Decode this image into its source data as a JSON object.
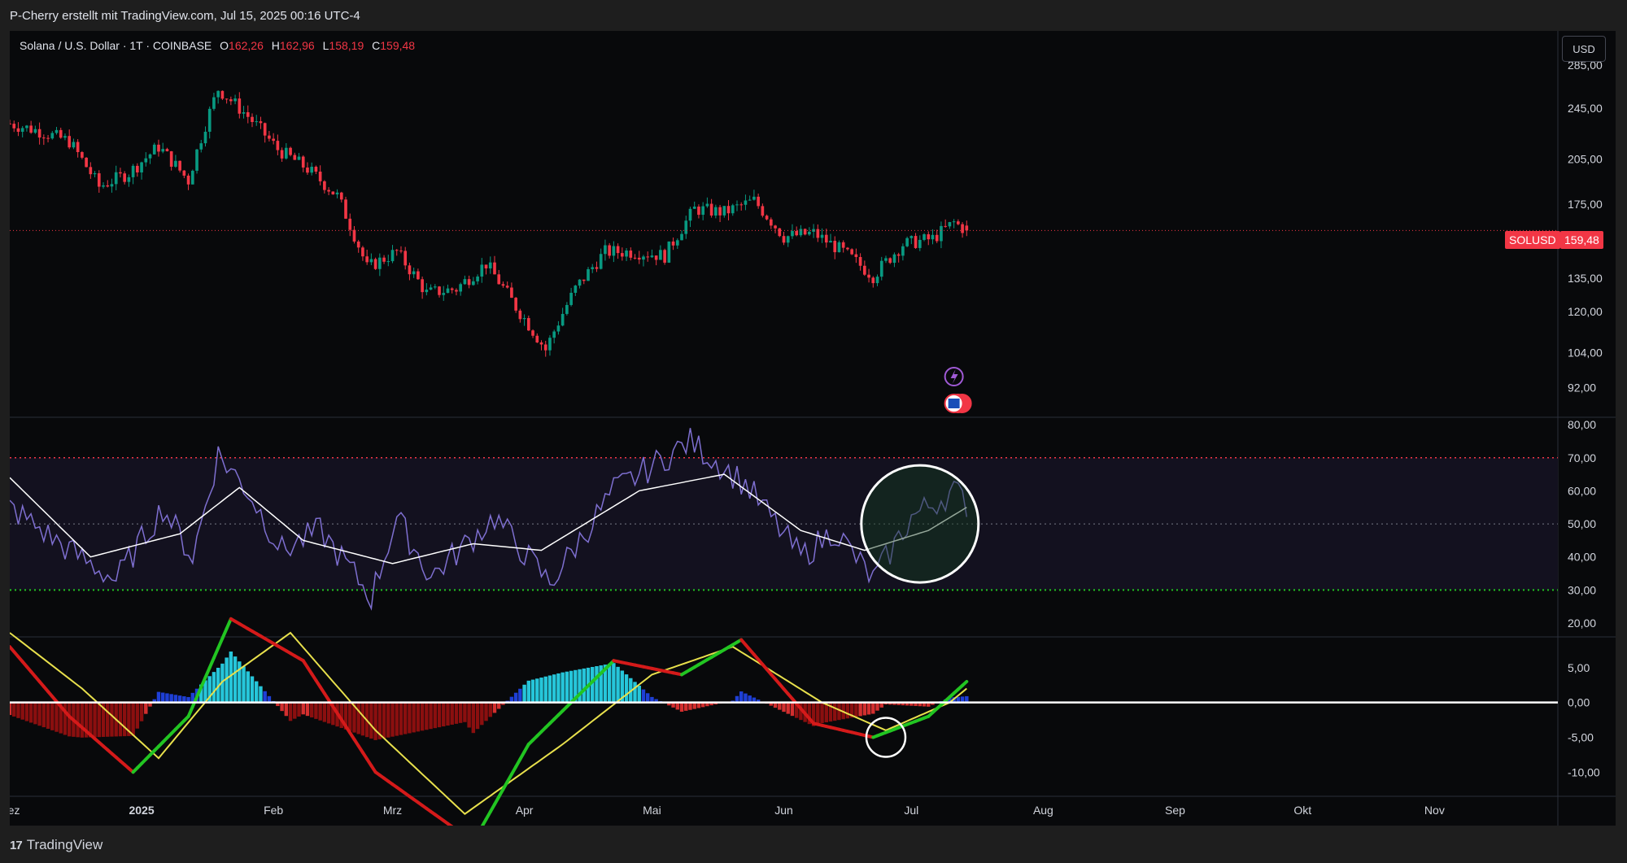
{
  "header": {
    "caption": "P-Cherry erstellt mit TradingView.com, Jul 15, 2025 00:16 UTC-4"
  },
  "legend": {
    "symbol": "Solana / U.S. Dollar · 1T · COINBASE",
    "open_label": "O",
    "open": "162,26",
    "high_label": "H",
    "high": "162,96",
    "low_label": "L",
    "low": "158,19",
    "close_label": "C",
    "close": "159,48"
  },
  "currency_button": "USD",
  "last_price": {
    "symbol": "SOLUSD",
    "value": "159,48"
  },
  "footer": {
    "brand": "TradingView",
    "logo_mark": "17"
  },
  "colors": {
    "background": "#08090b",
    "up": "#089981",
    "down": "#f23645",
    "rsi": "#7e6fd0",
    "rsi_ma": "#ffffff",
    "overbought": "#f23645",
    "oversold": "#22c522",
    "macd_fast": "#e8e04c",
    "histogram_pos": "#26c6da",
    "histogram_neg": "#b71c1c"
  },
  "chart_data": [
    {
      "type": "candlestick",
      "pane": "price",
      "scale": "log",
      "yticks": [
        92,
        104,
        120,
        135,
        175,
        205,
        245,
        285
      ],
      "ytick_labels": [
        "92,00",
        "104,00",
        "120,00",
        "135,00",
        "175,00",
        "205,00",
        "245,00",
        "285,00"
      ],
      "ylim": [
        86,
        305
      ],
      "xlim": [
        "2024-12-01",
        "2025-11-30"
      ],
      "x_ticks": [
        {
          "date": "2024-12-01",
          "label": "Dez"
        },
        {
          "date": "2025-01-01",
          "label": "2025"
        },
        {
          "date": "2025-02-01",
          "label": "Feb"
        },
        {
          "date": "2025-03-01",
          "label": "Mrz"
        },
        {
          "date": "2025-04-01",
          "label": "Apr"
        },
        {
          "date": "2025-05-01",
          "label": "Mai"
        },
        {
          "date": "2025-06-01",
          "label": "Jun"
        },
        {
          "date": "2025-07-01",
          "label": "Jul"
        },
        {
          "date": "2025-08-01",
          "label": "Aug"
        },
        {
          "date": "2025-09-01",
          "label": "Sep"
        },
        {
          "date": "2025-10-01",
          "label": "Okt"
        },
        {
          "date": "2025-11-01",
          "label": "Nov"
        }
      ],
      "close_waypoints": [
        [
          "2024-12-01",
          232
        ],
        [
          "2024-12-08",
          226
        ],
        [
          "2024-12-15",
          218
        ],
        [
          "2024-12-22",
          186
        ],
        [
          "2024-12-29",
          195
        ],
        [
          "2025-01-05",
          214
        ],
        [
          "2025-01-12",
          190
        ],
        [
          "2025-01-19",
          262
        ],
        [
          "2025-01-26",
          238
        ],
        [
          "2025-02-02",
          212
        ],
        [
          "2025-02-09",
          198
        ],
        [
          "2025-02-16",
          180
        ],
        [
          "2025-02-23",
          140
        ],
        [
          "2025-03-02",
          148
        ],
        [
          "2025-03-09",
          128
        ],
        [
          "2025-03-16",
          130
        ],
        [
          "2025-03-23",
          142
        ],
        [
          "2025-03-30",
          122
        ],
        [
          "2025-04-06",
          105
        ],
        [
          "2025-04-13",
          130
        ],
        [
          "2025-04-20",
          148
        ],
        [
          "2025-04-27",
          148
        ],
        [
          "2025-05-04",
          146
        ],
        [
          "2025-05-11",
          172
        ],
        [
          "2025-05-18",
          170
        ],
        [
          "2025-05-25",
          177
        ],
        [
          "2025-06-01",
          156
        ],
        [
          "2025-06-08",
          158
        ],
        [
          "2025-06-15",
          148
        ],
        [
          "2025-06-22",
          136
        ],
        [
          "2025-06-29",
          152
        ],
        [
          "2025-07-06",
          155
        ],
        [
          "2025-07-11",
          164
        ],
        [
          "2025-07-14",
          159.48
        ]
      ]
    },
    {
      "type": "line",
      "pane": "rsi",
      "yticks": [
        20,
        30,
        40,
        50,
        60,
        70,
        80
      ],
      "ytick_labels": [
        "20,00",
        "30,00",
        "40,00",
        "50,00",
        "60,00",
        "70,00",
        "80,00"
      ],
      "ylim": [
        20,
        82
      ],
      "levels": {
        "overbought": 70,
        "middle": 50,
        "oversold": 30
      },
      "series": [
        {
          "values": [
            [
              "2024-12-01",
              55
            ],
            [
              "2024-12-15",
              42
            ],
            [
              "2024-12-26",
              33
            ],
            [
              "2025-01-06",
              55
            ],
            [
              "2025-01-13",
              40
            ],
            [
              "2025-01-19",
              71
            ],
            [
              "2025-01-26",
              60
            ],
            [
              "2025-02-03",
              42
            ],
            [
              "2025-02-12",
              48
            ],
            [
              "2025-02-24",
              28
            ],
            [
              "2025-03-02",
              52
            ],
            [
              "2025-03-10",
              34
            ],
            [
              "2025-03-25",
              52
            ],
            [
              "2025-04-07",
              32
            ],
            [
              "2025-04-22",
              60
            ],
            [
              "2025-05-10",
              75
            ],
            [
              "2025-05-23",
              62
            ],
            [
              "2025-06-05",
              40
            ],
            [
              "2025-06-13",
              48
            ],
            [
              "2025-06-22",
              33
            ],
            [
              "2025-07-01",
              52
            ],
            [
              "2025-07-11",
              60
            ],
            [
              "2025-07-14",
              56
            ]
          ]
        },
        {
          "values": [
            [
              "2024-12-01",
              64
            ],
            [
              "2024-12-20",
              40
            ],
            [
              "2025-01-10",
              47
            ],
            [
              "2025-01-24",
              61
            ],
            [
              "2025-02-08",
              45
            ],
            [
              "2025-03-01",
              38
            ],
            [
              "2025-03-20",
              44
            ],
            [
              "2025-04-05",
              42
            ],
            [
              "2025-04-28",
              60
            ],
            [
              "2025-05-18",
              65
            ],
            [
              "2025-06-05",
              48
            ],
            [
              "2025-06-20",
              42
            ],
            [
              "2025-07-05",
              48
            ],
            [
              "2025-07-14",
              55
            ]
          ]
        }
      ]
    },
    {
      "type": "line",
      "pane": "macd",
      "yticks": [
        -10,
        -5,
        0,
        5
      ],
      "ytick_labels": [
        "-10,00",
        "-5,00",
        "0,00",
        "5,00"
      ],
      "ylim": [
        -13,
        10
      ],
      "series": [
        {
          "values": [
            [
              "2024-12-01",
              8
            ],
            [
              "2024-12-15",
              -2
            ],
            [
              "2024-12-30",
              -10
            ],
            [
              "2025-01-12",
              -2
            ],
            [
              "2025-01-22",
              12
            ],
            [
              "2025-02-08",
              6
            ],
            [
              "2025-02-25",
              -10
            ],
            [
              "2025-03-20",
              -20
            ],
            [
              "2025-04-02",
              -6
            ],
            [
              "2025-04-22",
              6
            ],
            [
              "2025-05-08",
              4
            ],
            [
              "2025-05-22",
              9
            ],
            [
              "2025-06-08",
              -3
            ],
            [
              "2025-06-22",
              -5
            ],
            [
              "2025-07-05",
              -2
            ],
            [
              "2025-07-14",
              3
            ]
          ]
        },
        {
          "values": [
            [
              "2024-12-01",
              10
            ],
            [
              "2024-12-18",
              2
            ],
            [
              "2025-01-05",
              -8
            ],
            [
              "2025-01-20",
              3
            ],
            [
              "2025-02-05",
              10
            ],
            [
              "2025-02-25",
              -4
            ],
            [
              "2025-03-18",
              -16
            ],
            [
              "2025-04-10",
              -6
            ],
            [
              "2025-05-01",
              4
            ],
            [
              "2025-05-20",
              8
            ],
            [
              "2025-06-10",
              0
            ],
            [
              "2025-06-25",
              -4
            ],
            [
              "2025-07-10",
              0
            ],
            [
              "2025-07-14",
              2
            ]
          ]
        }
      ]
    }
  ]
}
